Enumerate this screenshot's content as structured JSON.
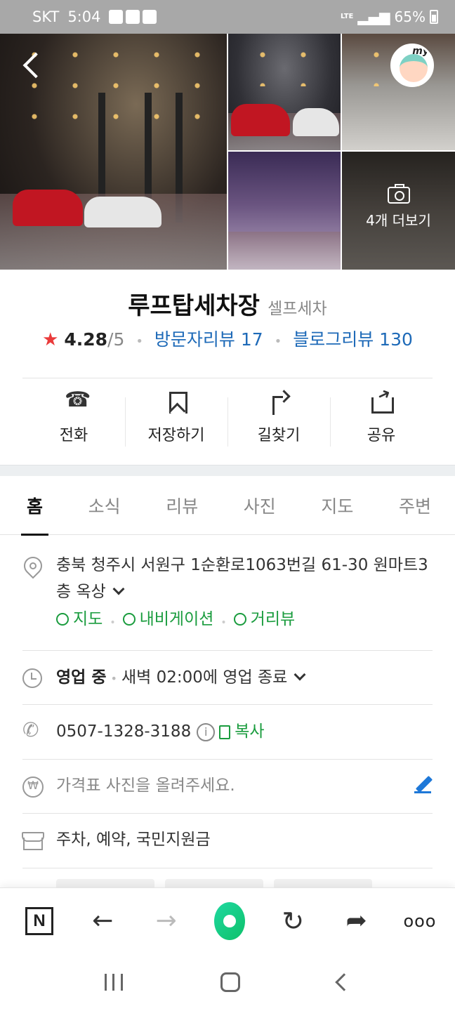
{
  "status_bar": {
    "carrier": "SKT",
    "time": "5:04",
    "network": "LTE",
    "battery": "65%"
  },
  "gallery": {
    "more_label": "4개 더보기",
    "avatar_label": "my"
  },
  "place": {
    "name": "루프탑세차장",
    "category": "셀프세차",
    "rating": "4.28",
    "rating_max": "/5",
    "visitor_reviews": "방문자리뷰 17",
    "blog_reviews": "블로그리뷰 130"
  },
  "actions": [
    {
      "label": "전화"
    },
    {
      "label": "저장하기"
    },
    {
      "label": "길찾기"
    },
    {
      "label": "공유"
    }
  ],
  "tabs": [
    {
      "label": "홈"
    },
    {
      "label": "소식"
    },
    {
      "label": "리뷰"
    },
    {
      "label": "사진"
    },
    {
      "label": "지도"
    },
    {
      "label": "주변"
    }
  ],
  "active_tab": "홈",
  "info": {
    "address": "충북 청주시 서원구 1순환로1063번길 61-30 원마트3층 옥상",
    "links": {
      "map": "지도",
      "navigation": "내비게이션",
      "street_view": "거리뷰"
    },
    "hours_status": "영업 중",
    "hours_detail": "새벽 02:00에 영업 종료",
    "phone": "0507-1328-3188",
    "copy_label": "복사",
    "price_placeholder": "가격표 사진을 올려주세요.",
    "amenities": "주차, 예약, 국민지원금"
  },
  "colors": {
    "link_blue": "#1e6ab8",
    "link_green": "#1a9c3e",
    "star_red": "#ea3b3b",
    "accent_green": "#0ec16a"
  }
}
